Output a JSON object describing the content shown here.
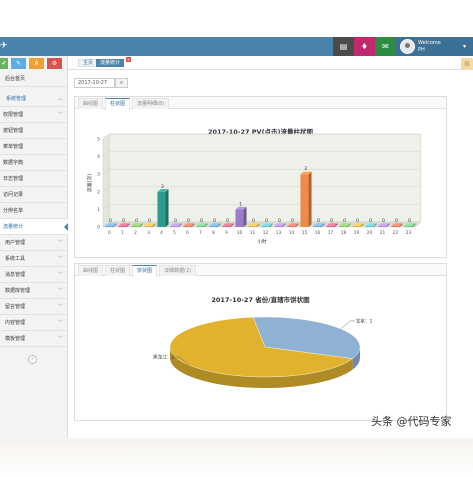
{
  "header": {
    "welcome": "Welcome",
    "user_name": "PH",
    "brand_icon": "paper-plane-icon",
    "icons": [
      "monitor-icon",
      "bell-icon",
      "envelope-icon"
    ]
  },
  "sidebar": {
    "shortcuts": [
      "✔",
      "✎",
      "A",
      "⚙"
    ],
    "items": [
      {
        "label": "后台首页",
        "type": "link"
      },
      {
        "label": "系统管理",
        "type": "parent",
        "expanded": true
      },
      {
        "label": "权限管理",
        "type": "sub"
      },
      {
        "label": "按钮管理",
        "type": "sub"
      },
      {
        "label": "菜单管理",
        "type": "sub"
      },
      {
        "label": "数据字典",
        "type": "sub"
      },
      {
        "label": "日志管理",
        "type": "sub"
      },
      {
        "label": "访问记录",
        "type": "sub"
      },
      {
        "label": "分辨名单",
        "type": "sub"
      },
      {
        "label": "流量统计",
        "type": "sub",
        "active": true
      },
      {
        "label": "用户管理",
        "type": "group"
      },
      {
        "label": "系统工具",
        "type": "group"
      },
      {
        "label": "消息管理",
        "type": "group"
      },
      {
        "label": "数据库管理",
        "type": "group"
      },
      {
        "label": "留言管理",
        "type": "group"
      },
      {
        "label": "内容管理",
        "type": "group"
      },
      {
        "label": "模板管理",
        "type": "group"
      }
    ]
  },
  "breadcrumb": {
    "home": "主页",
    "current": "流量统计"
  },
  "filter": {
    "date_value": "2017-10-27",
    "search_icon": "search-icon"
  },
  "panel1": {
    "tabs": [
      "曲线图",
      "柱状图",
      "流量明细(8)"
    ],
    "active_tab": 1
  },
  "panel2": {
    "tabs": [
      "曲线图",
      "柱状图",
      "饼状图",
      "详细数据(2)"
    ],
    "active_tab": 2
  },
  "chart_data": [
    {
      "type": "bar",
      "title": "2017-10-27 PV(点击)流量柱状图",
      "xlabel": "小时",
      "ylabel": "流量(次)",
      "categories": [
        "0",
        "1",
        "2",
        "3",
        "4",
        "5",
        "6",
        "7",
        "8",
        "9",
        "10",
        "11",
        "12",
        "13",
        "14",
        "15",
        "16",
        "17",
        "18",
        "19",
        "20",
        "21",
        "22",
        "23"
      ],
      "values": [
        0,
        0,
        0,
        0,
        2,
        0,
        0,
        0,
        0,
        0,
        1,
        0,
        0,
        0,
        0,
        3,
        0,
        0,
        0,
        0,
        0,
        0,
        0,
        0
      ],
      "ylim": [
        0,
        5
      ],
      "yticks": [
        0,
        1,
        2,
        3,
        4,
        5
      ],
      "style": "3d",
      "colors": {
        "4": "#2f9b8c",
        "10": "#9a7fc7",
        "15": "#f08a4b",
        "base_palette": [
          "#7aa7d6",
          "#d46a8a",
          "#8ac26b",
          "#e6b550",
          "#6bc2c6",
          "#b48ad6",
          "#e07a6a",
          "#7cc38d"
        ]
      }
    },
    {
      "type": "pie",
      "title": "2017-10-27 省份/直辖市饼状图",
      "slices": [
        {
          "label": "北京：1",
          "value": 1,
          "color": "#8fb2d4"
        },
        {
          "label": "黑龙江：2",
          "value": 2,
          "color": "#e0b22e"
        }
      ],
      "style": "3d"
    }
  ],
  "watermark": "头条 @代码专家"
}
